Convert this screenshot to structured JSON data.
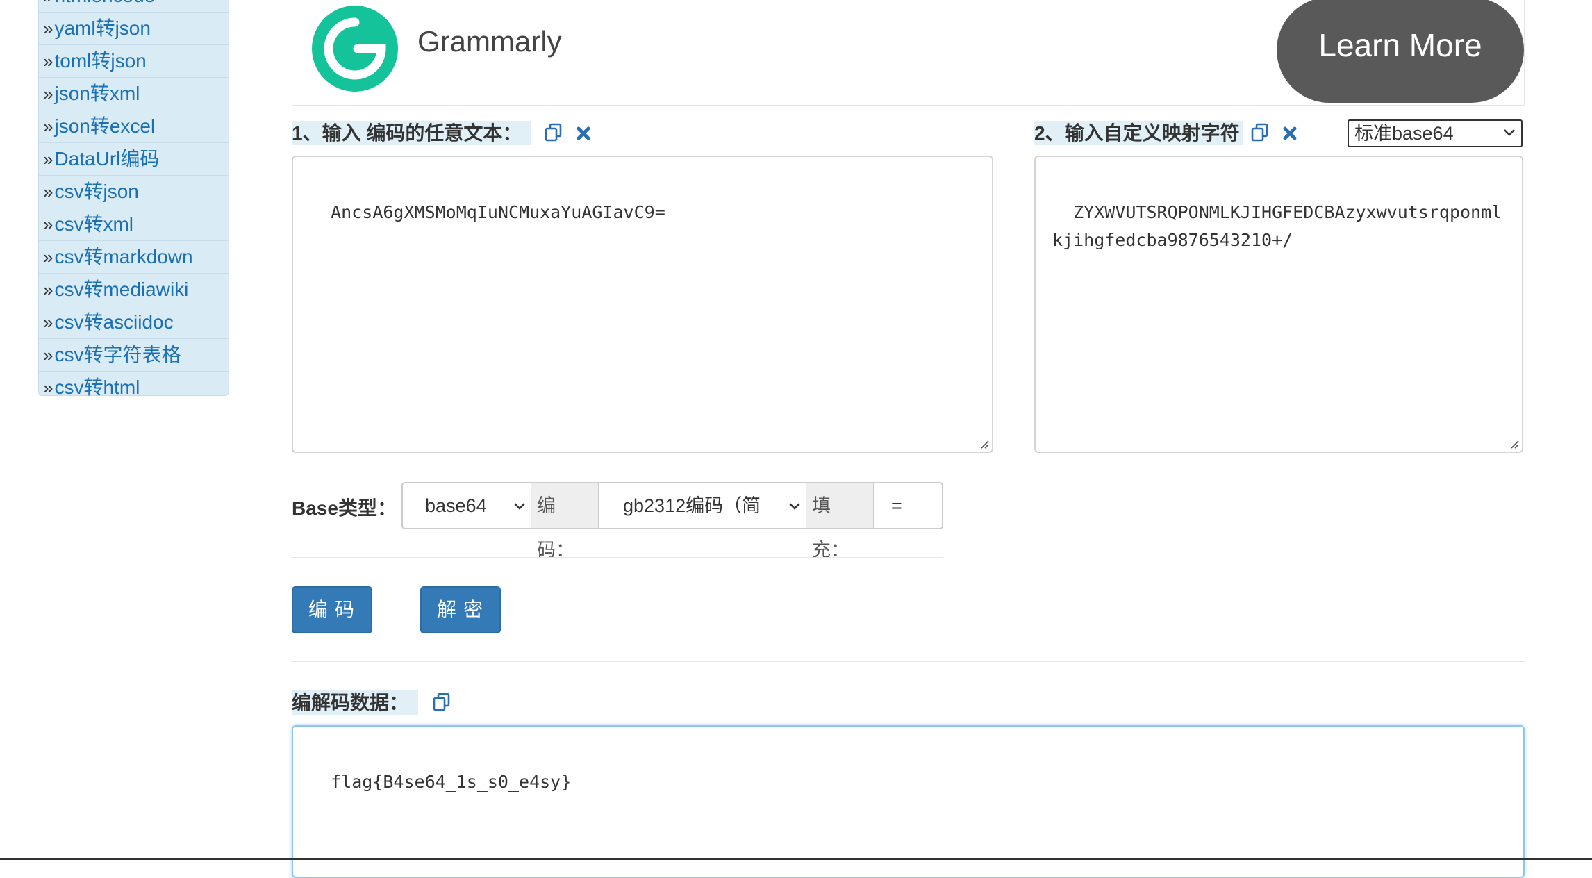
{
  "sidebar": {
    "items": [
      {
        "label": "htmlencode"
      },
      {
        "label": "yaml转json"
      },
      {
        "label": "toml转json"
      },
      {
        "label": "json转xml"
      },
      {
        "label": "json转excel"
      },
      {
        "label": "DataUrl编码"
      },
      {
        "label": "csv转json"
      },
      {
        "label": "csv转xml"
      },
      {
        "label": "csv转markdown"
      },
      {
        "label": "csv转mediawiki"
      },
      {
        "label": "csv转asciidoc"
      },
      {
        "label": "csv转字符表格"
      },
      {
        "label": "csv转html"
      }
    ],
    "bullet": "»"
  },
  "ad": {
    "brand": "Grammarly",
    "cta": "Learn More",
    "brand_color": "#15c39a"
  },
  "input_section": {
    "label": "1、输入 编码的任意文本：",
    "value": "AncsA6gXMSMoMqIuNCMuxaYuAGIavC9="
  },
  "mapping_section": {
    "label": "2、输入自定义映射字符",
    "value": "ZYXWVUTSRQPONMLKJIHGFEDCBAzyxwvutsrqponmlkjihgfedcba9876543210+/",
    "preset_selected": "标准base64"
  },
  "options": {
    "base_type_label": "Base类型：",
    "base_type_value": "base64",
    "encoding_label": "编码：",
    "encoding_value": "gb2312编码（简",
    "padding_label": "填充：",
    "padding_value": "="
  },
  "actions": {
    "encode_label": "编码",
    "decode_label": "解密"
  },
  "output_section": {
    "label": "编解码数据：",
    "value": "flag{B4se64_1s_s0_e4sy}"
  },
  "colors": {
    "primary": "#337ab7",
    "sidebar_bg": "#d9ebf5",
    "link": "#1a6fb5",
    "clear_icon": "#2a6db0"
  }
}
